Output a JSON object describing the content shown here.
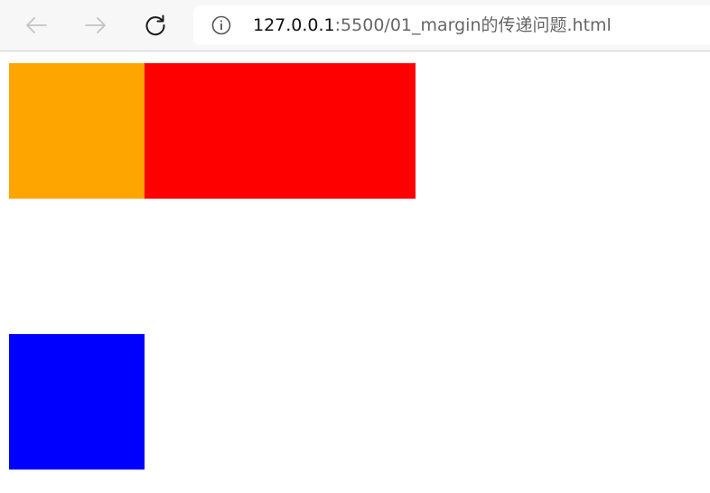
{
  "browser": {
    "url_host": "127.0.0.1",
    "url_rest": ":5500/01_margin的传递问题.html",
    "icons": {
      "back": "arrow-left-icon",
      "forward": "arrow-right-icon",
      "reload": "reload-icon",
      "info": "info-icon"
    }
  },
  "page": {
    "boxes": [
      {
        "name": "orange-box",
        "color": "#ffa500"
      },
      {
        "name": "red-box",
        "color": "#ff0000"
      },
      {
        "name": "blue-box",
        "color": "#0000ff"
      }
    ]
  }
}
